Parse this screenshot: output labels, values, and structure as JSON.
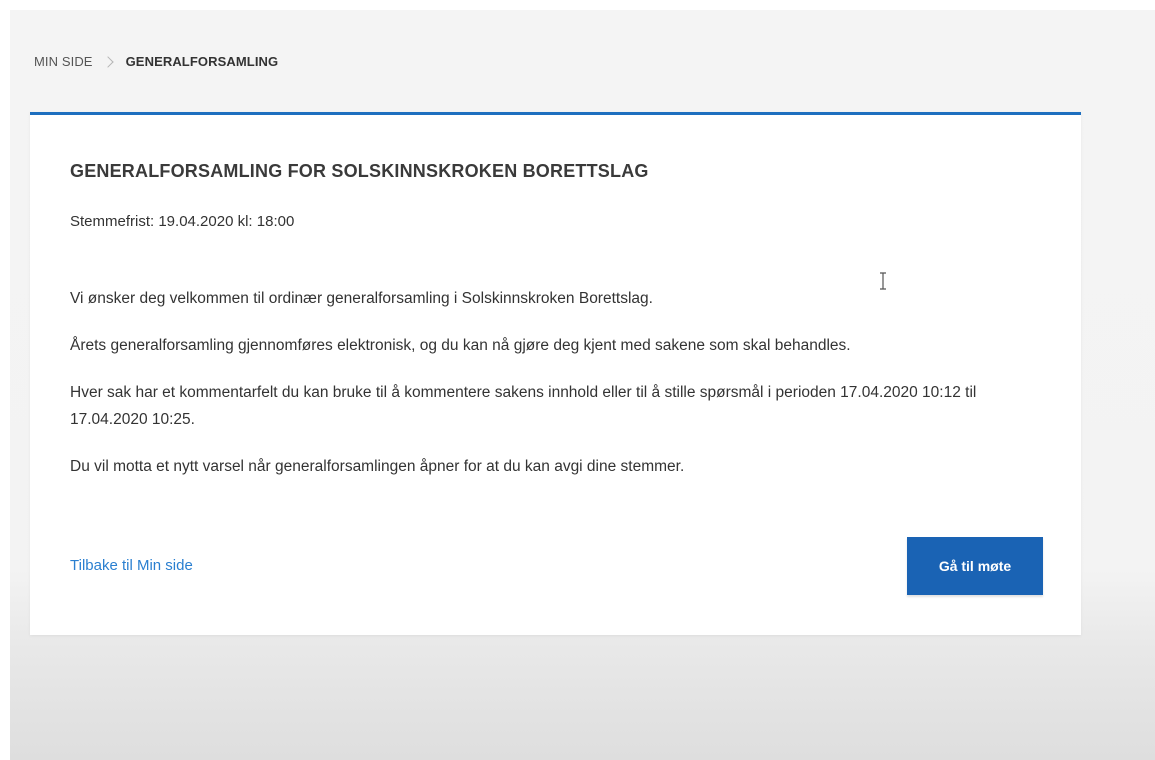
{
  "breadcrumb": {
    "home": "MIN SIDE",
    "current": "GENERALFORSAMLING"
  },
  "card": {
    "title": "GENERALFORSAMLING FOR SOLSKINNSKROKEN BORETTSLAG",
    "deadline": "Stemmefrist: 19.04.2020 kl: 18:00",
    "paragraphs": [
      "Vi ønsker deg velkommen til ordinær generalforsamling i Solskinnskroken Borettslag.",
      "Årets generalforsamling gjennomføres elektronisk, og du kan nå gjøre deg kjent med sakene som skal behandles.",
      "Hver sak har et kommentarfelt du kan bruke til å kommentere sakens innhold eller til å stille spørsmål i perioden 17.04.2020 10:12 til 17.04.2020 10:25.",
      "Du vil motta et nytt varsel når generalforsamlingen åpner for at du kan avgi dine stemmer."
    ],
    "back_link": "Tilbake til Min side",
    "go_button": "Gå til møte"
  },
  "colors": {
    "accent": "#1e6fbf",
    "button": "#1a63b4",
    "link": "#2a7fd0"
  },
  "icons": {
    "separator": "chevron-right-icon",
    "cursor": "text-cursor-icon"
  }
}
